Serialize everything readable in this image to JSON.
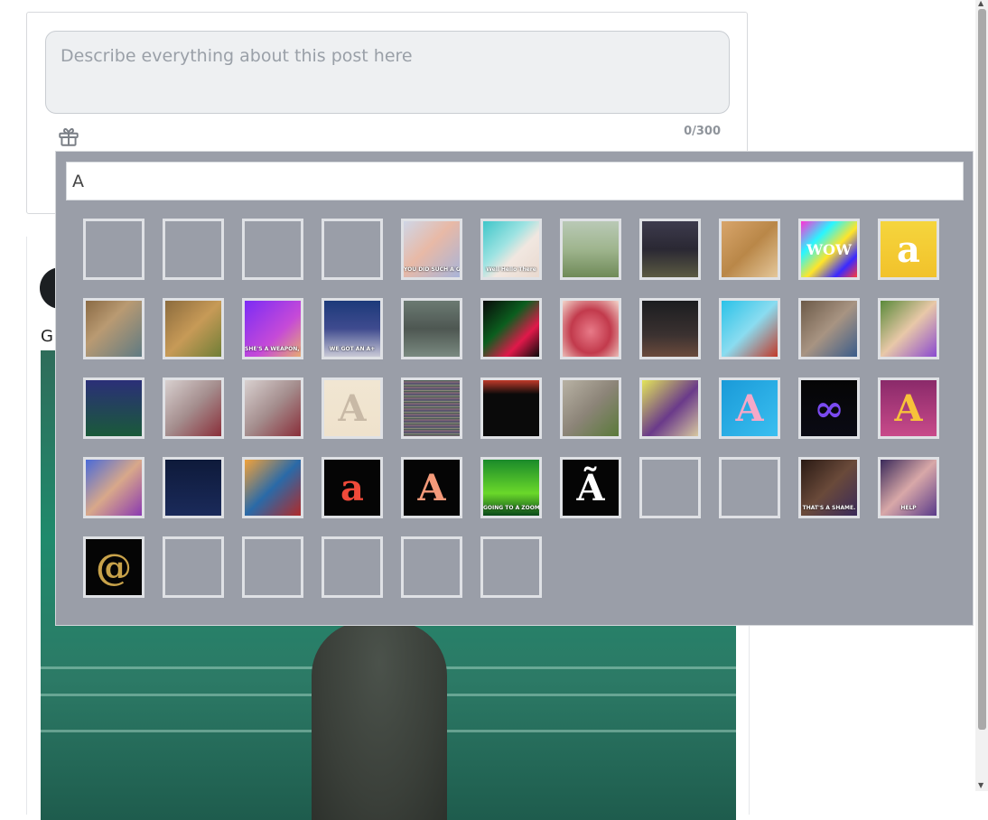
{
  "composer": {
    "description_placeholder": "Describe everything about this post here",
    "description_value": "",
    "char_count": "0/300",
    "gift_icon": "gift-icon"
  },
  "post": {
    "author_partial": "G"
  },
  "gif_picker": {
    "search_value": "A",
    "tiles": [
      {
        "bg": "",
        "caption": "",
        "glyph": "",
        "glyph_color": ""
      },
      {
        "bg": "",
        "caption": "",
        "glyph": "",
        "glyph_color": ""
      },
      {
        "bg": "",
        "caption": "",
        "glyph": "",
        "glyph_color": ""
      },
      {
        "bg": "",
        "caption": "",
        "glyph": "",
        "glyph_color": ""
      },
      {
        "bg": "linear-gradient(135deg,#cfd6e6 0%,#e8b9a6 45%,#a8b4d8 100%)",
        "caption": "YOU DID SUCH A GOOD JOB",
        "glyph": "",
        "glyph_color": ""
      },
      {
        "bg": "linear-gradient(135deg,#3fc6c9 0%,#9ee3e2 40%,#f1e7e0 60%,#e9d9cf 100%)",
        "caption": "Well Hello There",
        "glyph": "",
        "glyph_color": ""
      },
      {
        "bg": "linear-gradient(180deg,#b9c9b6 0%,#9fb58e 50%,#6f8a58 100%)",
        "caption": "",
        "glyph": "",
        "glyph_color": ""
      },
      {
        "bg": "linear-gradient(180deg,#3d3b4d 0%,#2a2833 50%,#5b5a42 100%)",
        "caption": "",
        "glyph": "",
        "glyph_color": ""
      },
      {
        "bg": "linear-gradient(135deg,#d8a56b 0%,#b98748 50%,#e4c79a 100%)",
        "caption": "",
        "glyph": "",
        "glyph_color": ""
      },
      {
        "bg": "linear-gradient(135deg,#ff2fd6 0%,#2af5ff 30%,#ffe52a 55%,#3a2aff 80%,#ff3b3b 100%)",
        "caption": "",
        "glyph": "WOW",
        "glyph_color": "#ffffff"
      },
      {
        "bg": "linear-gradient(180deg,#f5d53d 0%,#f2c22b 100%)",
        "caption": "",
        "glyph": "a",
        "glyph_color": "#ffffff"
      },
      {
        "bg": "linear-gradient(135deg,#8a6a44 0%,#b99a72 40%,#5f7a82 100%)",
        "caption": "",
        "glyph": "",
        "glyph_color": ""
      },
      {
        "bg": "linear-gradient(135deg,#8b6b3d 0%,#c79a57 50%,#6f7e36 100%)",
        "caption": "",
        "glyph": "",
        "glyph_color": ""
      },
      {
        "bg": "linear-gradient(135deg,#7b2cf5 0%,#c54ad8 60%,#e6aa72 100%)",
        "caption": "SHE'S A WEAPON, MAN",
        "glyph": "",
        "glyph_color": ""
      },
      {
        "bg": "linear-gradient(180deg,#1c3a7a 0%,#3f4b8f 50%,#c9c9d6 100%)",
        "caption": "WE GOT AN A+",
        "glyph": "",
        "glyph_color": ""
      },
      {
        "bg": "linear-gradient(180deg,#6b7a72 0%,#4e5752 50%,#7a8a80 100%)",
        "caption": "",
        "glyph": "",
        "glyph_color": ""
      },
      {
        "bg": "linear-gradient(135deg,#0a0a0a 0%,#0b5e1e 40%,#e0194a 70%,#0a0a0a 100%)",
        "caption": "",
        "glyph": "",
        "glyph_color": ""
      },
      {
        "bg": "radial-gradient(ellipse at 50% 55%,#e87a88 0%,#c23a4c 50%,#f3d6cc 100%)",
        "caption": "",
        "glyph": "",
        "glyph_color": ""
      },
      {
        "bg": "linear-gradient(180deg,#1b1d20 0%,#3a3130 60%,#6a4a3c 100%)",
        "caption": "",
        "glyph": "",
        "glyph_color": ""
      },
      {
        "bg": "linear-gradient(135deg,#2ac2e8 0%,#8adcf0 50%,#c23a2a 100%)",
        "caption": "",
        "glyph": "",
        "glyph_color": ""
      },
      {
        "bg": "linear-gradient(135deg,#6c5a48 0%,#a89482 50%,#3b5c8a 100%)",
        "caption": "",
        "glyph": "",
        "glyph_color": ""
      },
      {
        "bg": "linear-gradient(135deg,#5a8a3a 0%,#e8c8a8 50%,#8a4ad0 100%)",
        "caption": "",
        "glyph": "",
        "glyph_color": ""
      },
      {
        "bg": "linear-gradient(180deg,#2b2f78 0%,#1a5a3a 100%)",
        "caption": "",
        "glyph": "",
        "glyph_color": ""
      },
      {
        "bg": "linear-gradient(135deg,#d8d0cf 0%,#a48d8d 50%,#8a2f3a 100%)",
        "caption": "",
        "glyph": "",
        "glyph_color": ""
      },
      {
        "bg": "linear-gradient(135deg,#d8d0cf 0%,#a48d8d 50%,#8a2f3a 100%)",
        "caption": "",
        "glyph": "",
        "glyph_color": ""
      },
      {
        "bg": "linear-gradient(180deg,#f1e6d2 0%,#efe2cc 100%)",
        "caption": "",
        "glyph": "A",
        "glyph_color": "#c8b9a6"
      },
      {
        "bg": "repeating-linear-gradient(180deg,#3a5a4a 0px,#8a6a7a 2px,#4a4a6a 4px,#9a9a7a 6px)",
        "caption": "",
        "glyph": "",
        "glyph_color": ""
      },
      {
        "bg": "linear-gradient(180deg,#c03a2a 0%,#0a0a0a 25%,#0a0a0a 100%)",
        "caption": "",
        "glyph": "",
        "glyph_color": ""
      },
      {
        "bg": "linear-gradient(135deg,#b8b2a4 0%,#8c8478 50%,#5a7a3a 100%)",
        "caption": "",
        "glyph": "",
        "glyph_color": ""
      },
      {
        "bg": "linear-gradient(135deg,#e3e55a 0%,#6a3a8a 55%,#d8c8a0 100%)",
        "caption": "",
        "glyph": "",
        "glyph_color": ""
      },
      {
        "bg": "linear-gradient(135deg,#1a9ad8 0%,#3abff0 100%)",
        "caption": "",
        "glyph": "A",
        "glyph_color": "#f6a8c8"
      },
      {
        "bg": "linear-gradient(180deg,#050505 0%,#0a0a14 100%)",
        "caption": "",
        "glyph": "∞",
        "glyph_color": "#7a4af0"
      },
      {
        "bg": "linear-gradient(180deg,#8a2a6a 0%,#c84a8a 100%)",
        "caption": "",
        "glyph": "A",
        "glyph_color": "#f7c23a"
      },
      {
        "bg": "linear-gradient(135deg,#4a6ad8 0%,#d8a88a 50%,#8a3ab0 100%)",
        "caption": "",
        "glyph": "",
        "glyph_color": ""
      },
      {
        "bg": "linear-gradient(180deg,#0e1a3a 0%,#1a2a5a 100%)",
        "caption": "",
        "glyph": "",
        "glyph_color": ""
      },
      {
        "bg": "linear-gradient(135deg,#f2a23a 0%,#2a6aa8 50%,#b02a2a 100%)",
        "caption": "",
        "glyph": "",
        "glyph_color": ""
      },
      {
        "bg": "#050505",
        "caption": "",
        "glyph": "a",
        "glyph_color": "#f04a3a"
      },
      {
        "bg": "#050505",
        "caption": "",
        "glyph": "A",
        "glyph_color": "#f49a7a"
      },
      {
        "bg": "linear-gradient(180deg,#1a8a2a 0%,#6ad82a 60%,#0a4a1a 100%)",
        "caption": "GOING TO A ZOOM PARTY",
        "glyph": "",
        "glyph_color": ""
      },
      {
        "bg": "#050505",
        "caption": "",
        "glyph": "Ã",
        "glyph_color": "#ffffff"
      },
      {
        "bg": "",
        "caption": "",
        "glyph": "",
        "glyph_color": ""
      },
      {
        "bg": "",
        "caption": "",
        "glyph": "",
        "glyph_color": ""
      },
      {
        "bg": "linear-gradient(135deg,#2a1a14 0%,#6a4a3a 50%,#3a2a5a 100%)",
        "caption": "THAT'S A SHAME.",
        "glyph": "",
        "glyph_color": ""
      },
      {
        "bg": "linear-gradient(135deg,#3a2a5a 0%,#d8a8a8 50%,#5a3a8a 100%)",
        "caption": "HELP",
        "glyph": "",
        "glyph_color": ""
      },
      {
        "bg": "#050505",
        "caption": "",
        "glyph": "@",
        "glyph_color": "#c8a24a"
      },
      {
        "bg": "",
        "caption": "",
        "glyph": "",
        "glyph_color": ""
      },
      {
        "bg": "",
        "caption": "",
        "glyph": "",
        "glyph_color": ""
      },
      {
        "bg": "",
        "caption": "",
        "glyph": "",
        "glyph_color": ""
      },
      {
        "bg": "",
        "caption": "",
        "glyph": "",
        "glyph_color": ""
      },
      {
        "bg": "",
        "caption": "",
        "glyph": "",
        "glyph_color": ""
      }
    ]
  }
}
